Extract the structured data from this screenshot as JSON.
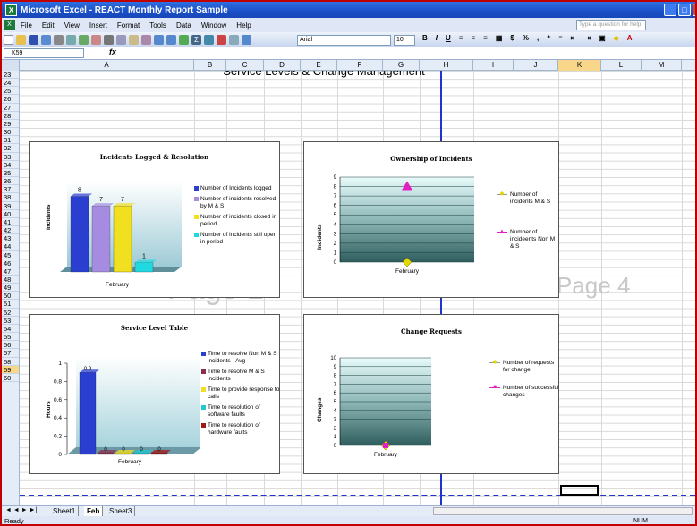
{
  "window": {
    "title": "Microsoft Excel - REACT Monthly Report Sample"
  },
  "menu": {
    "items": [
      "File",
      "Edit",
      "View",
      "Insert",
      "Format",
      "Tools",
      "Data",
      "Window",
      "Help"
    ],
    "ask_placeholder": "Type a question for help"
  },
  "toolbar": {
    "font": "Arial",
    "size": "10",
    "bold": "B",
    "italic": "I",
    "underline": "U",
    "currency": "$",
    "percent": "%"
  },
  "formula_bar": {
    "name_box": "K59",
    "fx": "fx",
    "value": ""
  },
  "columns": [
    "A",
    "B",
    "C",
    "D",
    "E",
    "F",
    "G",
    "H",
    "I",
    "J",
    "K",
    "L",
    "M"
  ],
  "rows": [
    "23",
    "24",
    "25",
    "26",
    "27",
    "28",
    "29",
    "30",
    "31",
    "32",
    "33",
    "34",
    "35",
    "36",
    "37",
    "38",
    "39",
    "40",
    "41",
    "42",
    "43",
    "44",
    "45",
    "46",
    "47",
    "48",
    "49",
    "50",
    "51",
    "52",
    "53",
    "54",
    "55",
    "56",
    "57",
    "58",
    "59",
    "60"
  ],
  "sheet": {
    "heading": "Service Levels & Change Management",
    "watermark_page1": "Page 1",
    "watermark_page4": "Page 4"
  },
  "charts": {
    "incidents": {
      "title": "Incidents Logged & Resolution",
      "ylabel": "Incidents",
      "category": "February",
      "legend": [
        "Number of Incidents logged",
        "Number of incidents resolved by M & S",
        "Number of incidents closed in period",
        "Number of incidents still open in period"
      ]
    },
    "ownership": {
      "title": "Ownership of Incidents",
      "ylabel": "Incidents",
      "category": "February",
      "ticks": [
        "0",
        "1",
        "2",
        "3",
        "4",
        "5",
        "6",
        "7",
        "8",
        "9"
      ],
      "legend": [
        "Number of incidents M & S",
        "Number of incideents Non M & S"
      ]
    },
    "service": {
      "title": "Service Level Table",
      "ylabel": "Hours",
      "category": "February",
      "ticks": [
        "0",
        "0.2",
        "0.4",
        "0.6",
        "0.8",
        "1"
      ],
      "legend": [
        "Time to resolve Non M & S incidents - Avg",
        "Time to resolve M & S incidents",
        "Time to provide response to calls",
        "Time to resolution of software faults",
        "Time to resolution of hardware faults"
      ]
    },
    "changes": {
      "title": "Change Requests",
      "ylabel": "Changes",
      "category": "February",
      "ticks": [
        "0",
        "1",
        "2",
        "3",
        "4",
        "5",
        "6",
        "7",
        "8",
        "9",
        "10"
      ],
      "legend": [
        "Number of requests for change",
        "Number of successful changes"
      ]
    }
  },
  "chart_data": [
    {
      "type": "bar",
      "title": "Incidents Logged & Resolution",
      "ylabel": "Incidents",
      "categories": [
        "February"
      ],
      "series": [
        {
          "name": "Number of Incidents logged",
          "values": [
            8
          ],
          "color": "#2a3fcf"
        },
        {
          "name": "Number of incidents resolved by M & S",
          "values": [
            7
          ],
          "color": "#a58ce0"
        },
        {
          "name": "Number of incidents closed in period",
          "values": [
            7
          ],
          "color": "#f0e020"
        },
        {
          "name": "Number of incidents still open in period",
          "values": [
            1
          ],
          "color": "#20d8e0"
        }
      ],
      "data_labels": [
        "8",
        "7",
        "7",
        "1"
      ],
      "ylim": [
        0,
        9
      ]
    },
    {
      "type": "line",
      "title": "Ownership of Incidents",
      "ylabel": "Incidents",
      "categories": [
        "February"
      ],
      "series": [
        {
          "name": "Number of incidents M & S",
          "values": [
            0
          ],
          "color": "#e0d800"
        },
        {
          "name": "Number of incideents Non M & S",
          "values": [
            8
          ],
          "color": "#e020c0"
        }
      ],
      "ylim": [
        0,
        9
      ]
    },
    {
      "type": "bar",
      "title": "Service Level Table",
      "ylabel": "Hours",
      "categories": [
        "February"
      ],
      "series": [
        {
          "name": "Time to resolve Non M & S incidents - Avg",
          "values": [
            0.9
          ],
          "color": "#2a3fcf"
        },
        {
          "name": "Time to resolve M & S incidents",
          "values": [
            0
          ],
          "color": "#8a3050"
        },
        {
          "name": "Time to provide response to calls",
          "values": [
            0
          ],
          "color": "#f0e020"
        },
        {
          "name": "Time to resolution of software faults",
          "values": [
            0
          ],
          "color": "#20c8d0"
        },
        {
          "name": "Time to resolution of hardware faults",
          "values": [
            0
          ],
          "color": "#a01818"
        }
      ],
      "data_labels": [
        "0.9",
        "0",
        "0",
        "0",
        "0"
      ],
      "ylim": [
        0,
        1
      ]
    },
    {
      "type": "line",
      "title": "Change Requests",
      "ylabel": "Changes",
      "categories": [
        "February"
      ],
      "series": [
        {
          "name": "Number of requests for change",
          "values": [
            0
          ],
          "color": "#e0d800"
        },
        {
          "name": "Number of successful changes",
          "values": [
            0
          ],
          "color": "#e020c0"
        }
      ],
      "ylim": [
        0,
        10
      ]
    }
  ],
  "tabs": {
    "nav": "◄ ◄ ► ►|",
    "items": [
      "Sheet1",
      "Feb",
      "Sheet3"
    ],
    "active": "Feb"
  },
  "status": {
    "left": "Ready",
    "num": "NUM"
  },
  "colors": {
    "title_bar": "#1a4fc8",
    "page_break": "#2233cc",
    "frame": "#c00000"
  }
}
